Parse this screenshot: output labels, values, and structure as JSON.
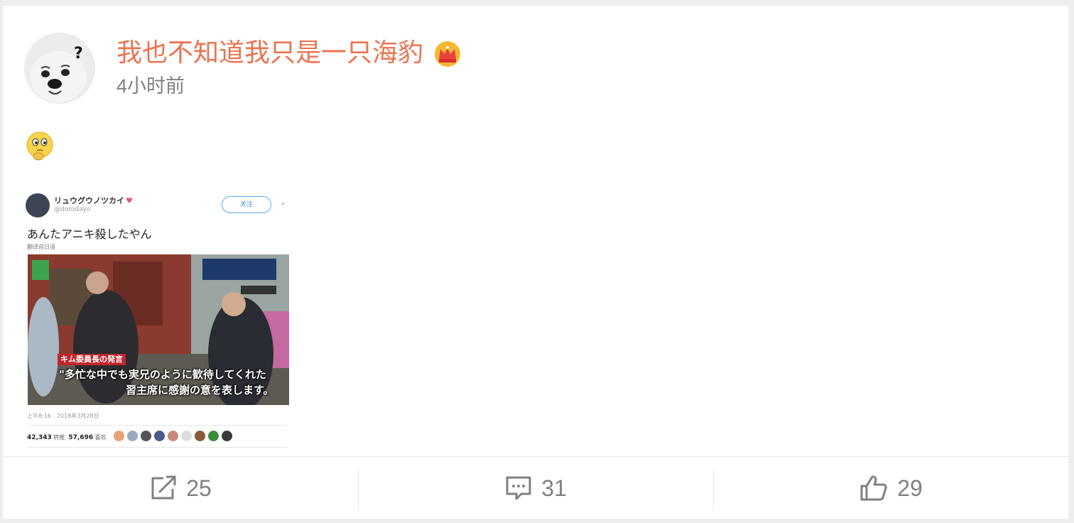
{
  "post": {
    "username": "我也不知道我只是一只海豹",
    "time": "4小时前",
    "user_badge_icon": "crown-icon",
    "content_emoji": "thinking-face-icon"
  },
  "embedded_tweet": {
    "name": "リュウグウノツカイ",
    "handle": "@dorodayo",
    "follow_label": "关注",
    "text": "あんたアニキ殺したやん",
    "translate_label": "翻译自日语",
    "caption_tag": "キム委員長の発言",
    "caption_line1": "\"多忙な中でも実兄のように歓待してくれた",
    "caption_line2": "習主席に感謝の意を表します。",
    "date": "上午8:16 - 2018年3月28日",
    "retweets": "42,343",
    "retweets_label": "转推",
    "likes": "57,696",
    "likes_label": "喜欢"
  },
  "actions": {
    "repost_count": "25",
    "comment_count": "31",
    "like_count": "29"
  },
  "colors": {
    "username": "#eb7350",
    "meta_text": "#808080",
    "divider": "#e6e6e6"
  }
}
